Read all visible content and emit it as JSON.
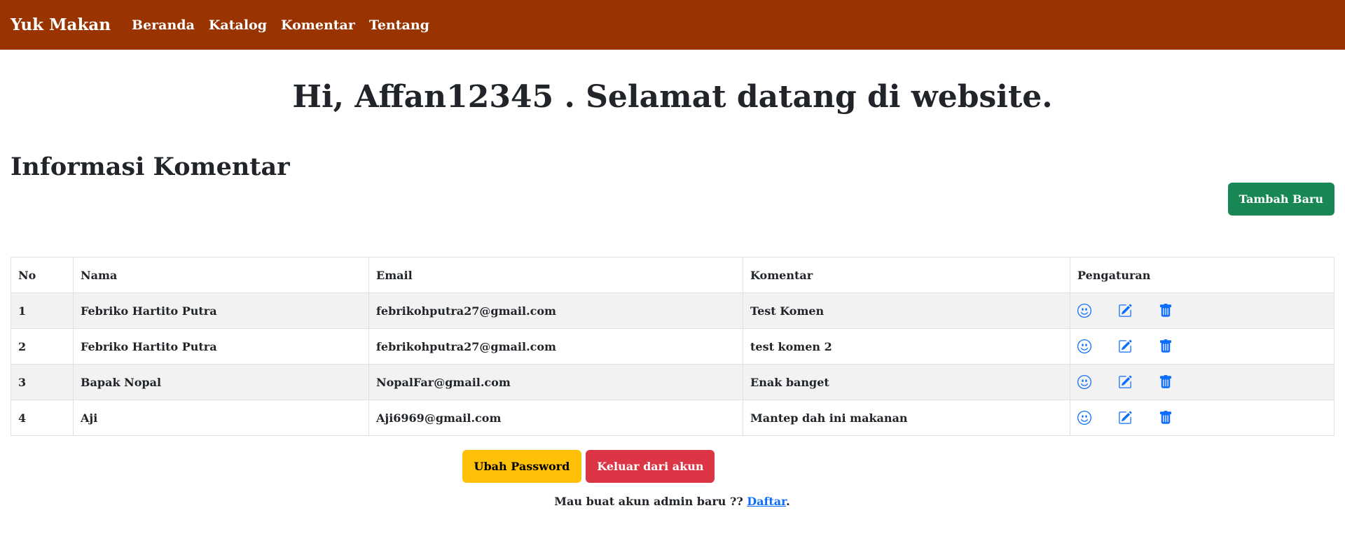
{
  "navbar": {
    "brand": "Yuk Makan",
    "links": [
      "Beranda",
      "Katalog",
      "Komentar",
      "Tentang"
    ]
  },
  "greeting": {
    "prefix": "Hi,",
    "username": "Affan12345",
    "suffix": ". Selamat datang di website."
  },
  "section": {
    "title": "Informasi Komentar",
    "add_button": "Tambah Baru"
  },
  "table": {
    "headers": [
      "No",
      "Nama",
      "Email",
      "Komentar",
      "Pengaturan"
    ],
    "rows": [
      {
        "no": "1",
        "nama": "Febriko Hartito Putra",
        "email": "febrikohputra27@gmail.com",
        "komentar": "Test Komen"
      },
      {
        "no": "2",
        "nama": "Febriko Hartito Putra",
        "email": "febrikohputra27@gmail.com",
        "komentar": "test komen 2"
      },
      {
        "no": "3",
        "nama": "Bapak Nopal",
        "email": "NopalFar@gmail.com",
        "komentar": "Enak banget"
      },
      {
        "no": "4",
        "nama": "Aji",
        "email": "Aji6969@gmail.com",
        "komentar": "Mantep dah ini makanan"
      }
    ],
    "action_icons": [
      "smile-icon",
      "edit-icon",
      "trash-icon"
    ]
  },
  "footer": {
    "change_password": "Ubah Password",
    "logout": "Keluar dari akun",
    "register_text": "Mau buat akun admin baru ??",
    "register_link": "Daftar",
    "register_end": "."
  },
  "colors": {
    "navbar": "#993300",
    "success": "#198754",
    "warning": "#ffc107",
    "danger": "#dc3545",
    "icon": "#0d6efd"
  }
}
